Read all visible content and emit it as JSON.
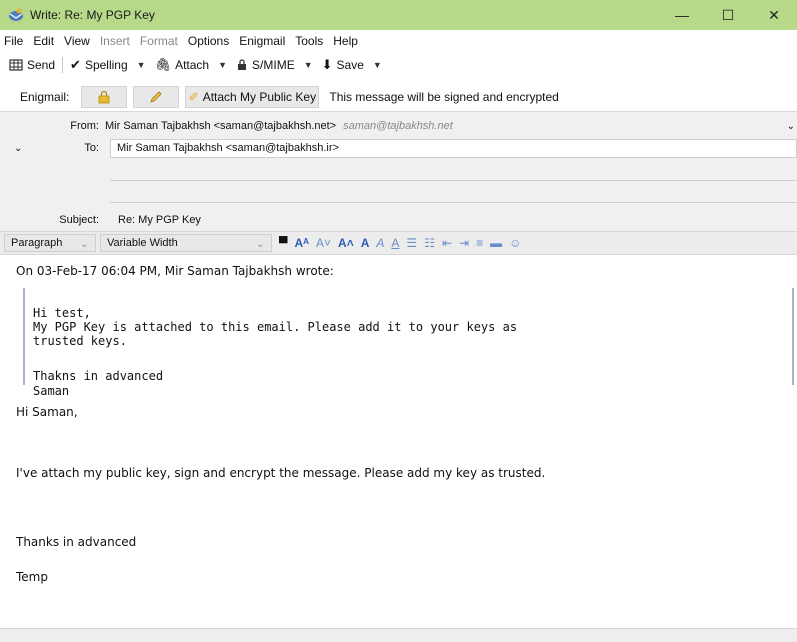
{
  "window": {
    "title": "Write: Re: My PGP Key",
    "controls": {
      "minimize": "—",
      "maximize": "☐",
      "close": "✕"
    }
  },
  "menubar": {
    "items": [
      {
        "label": "File",
        "disabled": false
      },
      {
        "label": "Edit",
        "disabled": false
      },
      {
        "label": "View",
        "disabled": false
      },
      {
        "label": "Insert",
        "disabled": true
      },
      {
        "label": "Format",
        "disabled": true
      },
      {
        "label": "Options",
        "disabled": false
      },
      {
        "label": "Enigmail",
        "disabled": false
      },
      {
        "label": "Tools",
        "disabled": false
      },
      {
        "label": "Help",
        "disabled": false
      }
    ]
  },
  "toolbar": {
    "send_label": "Send",
    "spelling_label": "Spelling",
    "attach_label": "Attach",
    "smime_label": "S/MIME",
    "save_label": "Save"
  },
  "enigmail": {
    "label": "Enigmail:",
    "attach_key_label": "Attach My Public Key",
    "status_text": "This message will be signed and encrypted"
  },
  "headers": {
    "from_label": "From:",
    "from_value": "Mir Saman Tajbakhsh <saman@tajbakhsh.net>",
    "from_identity": "saman@tajbakhsh.net",
    "to_label": "To:",
    "to_value": "Mir Saman Tajbakhsh <saman@tajbakhsh.ir>",
    "subject_label": "Subject:",
    "subject_value": "Re: My PGP Key"
  },
  "format": {
    "paragraph": "Paragraph",
    "font": "Variable Width"
  },
  "body": {
    "quote_header": "On 03-Feb-17 06:04 PM, Mir Saman Tajbakhsh wrote:",
    "quote_lines": [
      "Hi test,",
      "My PGP Key is attached to this email. Please add it to your keys as",
      "trusted keys.",
      "",
      "Thakns in advanced",
      "Saman"
    ],
    "greeting": "Hi Saman,",
    "message": "I've attach my public key, sign and encrypt the message. Please add my key as trusted.",
    "closing": "Thanks in advanced",
    "signature": "Temp"
  },
  "colors": {
    "titlebar": "#b6d98a",
    "quote_border": "#aab4cc",
    "pencil": "#f0c040"
  }
}
